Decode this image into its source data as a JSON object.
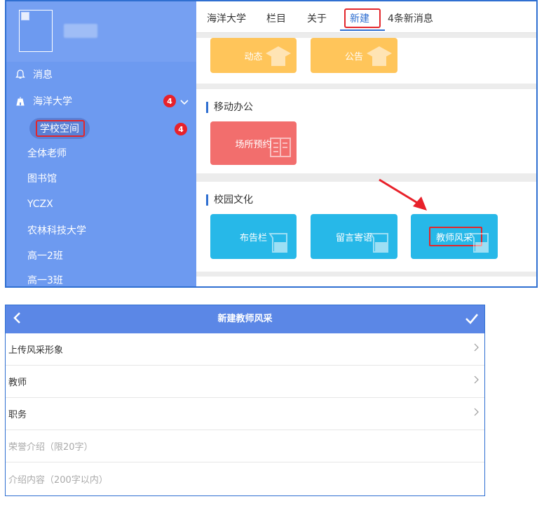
{
  "sidebar": {
    "items": [
      {
        "label": "消息",
        "icon": "bell-icon"
      },
      {
        "label": "海洋大学",
        "icon": "school-icon",
        "badge": "4"
      }
    ],
    "subitems": [
      {
        "label": "学校空间",
        "badge": "4"
      },
      {
        "label": "全体老师"
      },
      {
        "label": "图书馆"
      },
      {
        "label": "YCZX"
      },
      {
        "label": "农林科技大学"
      },
      {
        "label": "高一2班"
      },
      {
        "label": "高一3班"
      }
    ]
  },
  "topnav": {
    "items": [
      "海洋大学",
      "栏目",
      "关于",
      "新建",
      "4条新消息"
    ],
    "active": "新建"
  },
  "sections": {
    "first_tiles": [
      "动态",
      "公告"
    ],
    "mobile_office": {
      "title": "移动办公",
      "tiles": [
        "场所预约"
      ]
    },
    "campus_culture": {
      "title": "校园文化",
      "tiles": [
        "布告栏",
        "留言寄语",
        "教师风采"
      ]
    }
  },
  "form": {
    "title": "新建教师风采",
    "rows": [
      {
        "label": "上传风采形象",
        "type": "nav"
      },
      {
        "label": "教师",
        "type": "nav"
      },
      {
        "label": "职务",
        "type": "nav"
      },
      {
        "label": "荣誉介绍（限20字）",
        "type": "input"
      },
      {
        "label": "介绍内容（200字以内）",
        "type": "input"
      }
    ]
  },
  "colors": {
    "sidebar": "#6d9af0",
    "accent": "#2f6fd1",
    "highlight": "#e3262b",
    "tile_yellow": "#ffc55a",
    "tile_red": "#f26e6d",
    "tile_blue": "#27b8e8",
    "form_header": "#5b87e6"
  }
}
